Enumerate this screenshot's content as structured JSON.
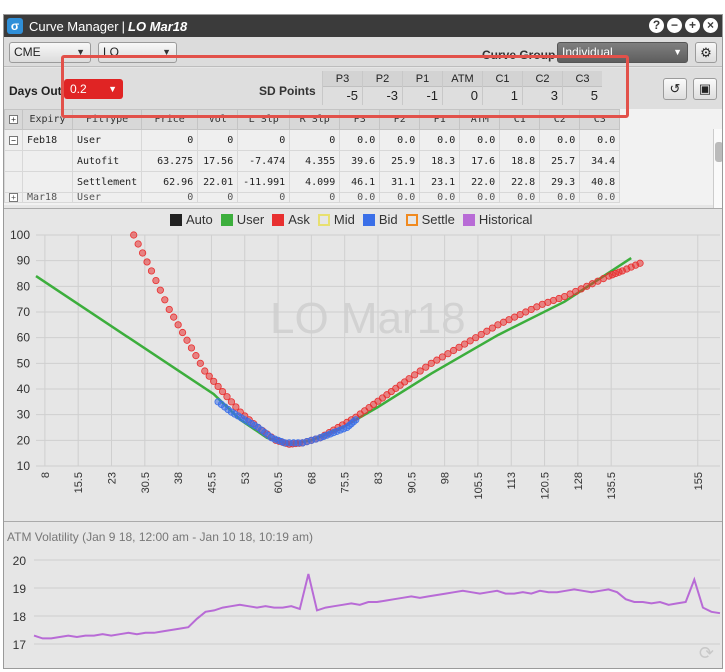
{
  "window": {
    "app_label": "Curve Manager",
    "separator": "|",
    "curve_label": "LO Mar18",
    "controls": {
      "help": "?",
      "minimize": "−",
      "add": "+",
      "close": "×"
    }
  },
  "toolbar": {
    "exchange_select": "CME",
    "product_select": "LO",
    "curve_group_label": "Curve Group",
    "curve_group_select": "Individual",
    "settings_icon": "gear-icon"
  },
  "params": {
    "days_out_label": "Days Out",
    "days_out_value": "0.2",
    "sd_points_label": "SD Points",
    "sd_points": [
      {
        "label": "P3",
        "value": "-5"
      },
      {
        "label": "P2",
        "value": "-3"
      },
      {
        "label": "P1",
        "value": "-1"
      },
      {
        "label": "ATM",
        "value": "0"
      },
      {
        "label": "C1",
        "value": "1"
      },
      {
        "label": "C2",
        "value": "3"
      },
      {
        "label": "C3",
        "value": "5"
      }
    ]
  },
  "table": {
    "columns": [
      "Expiry",
      "FitType",
      "Price",
      "Vol",
      "L Slp",
      "R Slp",
      "P3",
      "P2",
      "P1",
      "ATM",
      "C1",
      "C2",
      "C3"
    ],
    "rows": [
      {
        "expander": "−",
        "expiry": "Feb18",
        "fittype": "User",
        "price": "0",
        "vol": "0",
        "lslp": "0",
        "rslp": "0",
        "p3": "0.0",
        "p2": "0.0",
        "p1": "0.0",
        "atm": "0.0",
        "c1": "0.0",
        "c2": "0.0",
        "c3": "0.0"
      },
      {
        "expander": "",
        "expiry": "",
        "fittype": "Autofit",
        "price": "63.275",
        "vol": "17.56",
        "lslp": "-7.474",
        "rslp": "4.355",
        "p3": "39.6",
        "p2": "25.9",
        "p1": "18.3",
        "atm": "17.6",
        "c1": "18.8",
        "c2": "25.7",
        "c3": "34.4"
      },
      {
        "expander": "",
        "expiry": "",
        "fittype": "Settlement",
        "price": "62.96",
        "vol": "22.01",
        "lslp": "-11.991",
        "rslp": "4.099",
        "p3": "46.1",
        "p2": "31.1",
        "p1": "23.1",
        "atm": "22.0",
        "c1": "22.8",
        "c2": "29.3",
        "c3": "40.8"
      },
      {
        "expander": "+",
        "expiry": "Mar18",
        "fittype": "User",
        "price": "0",
        "vol": "0",
        "lslp": "0",
        "rslp": "0",
        "p3": "0.0",
        "p2": "0.0",
        "p1": "0.0",
        "atm": "0.0",
        "c1": "0.0",
        "c2": "0.0",
        "c3": "0.0"
      }
    ]
  },
  "legend": [
    {
      "label": "Auto",
      "color": "#222222",
      "style": "fill"
    },
    {
      "label": "User",
      "color": "#3cae3c",
      "style": "fill"
    },
    {
      "label": "Ask",
      "color": "#e83030",
      "style": "fill"
    },
    {
      "label": "Mid",
      "color": "#e8e070",
      "style": "outline"
    },
    {
      "label": "Bid",
      "color": "#3a6fe8",
      "style": "fill"
    },
    {
      "label": "Settle",
      "color": "#f08a20",
      "style": "outline"
    },
    {
      "label": "Historical",
      "color": "#b86bd6",
      "style": "fill"
    }
  ],
  "watermark": "LO Mar18",
  "chart_data": [
    {
      "type": "scatter",
      "title": "",
      "xlabel": "",
      "ylabel": "",
      "x_ticks": [
        "8",
        "15.5",
        "23",
        "30.5",
        "38",
        "45.5",
        "53",
        "60.5",
        "68",
        "75.5",
        "83",
        "90.5",
        "98",
        "105.5",
        "113",
        "120.5",
        "128",
        "135.5",
        "155"
      ],
      "xlim": [
        6,
        160
      ],
      "ylim": [
        10,
        100
      ],
      "y_ticks": [
        10,
        20,
        30,
        40,
        50,
        60,
        70,
        80,
        90,
        100
      ],
      "series": [
        {
          "name": "User",
          "kind": "line",
          "color": "#3cae3c",
          "points": [
            [
              6,
              84
            ],
            [
              46,
              38
            ],
            [
              52,
              28
            ],
            [
              58,
              21
            ],
            [
              63,
              18.5
            ],
            [
              68,
              20
            ],
            [
              75,
              25
            ],
            [
              83,
              33
            ],
            [
              95,
              46
            ],
            [
              110,
              61
            ],
            [
              125,
              74
            ],
            [
              140,
              91
            ]
          ]
        },
        {
          "name": "Ask",
          "kind": "markers",
          "color": "#e83030",
          "points": [
            [
              28,
              100
            ],
            [
              32,
              86
            ],
            [
              36,
              71
            ],
            [
              40,
              59
            ],
            [
              44,
              47
            ],
            [
              48,
              39
            ],
            [
              52,
              31
            ],
            [
              56,
              25
            ],
            [
              60,
              20
            ],
            [
              63,
              18.5
            ],
            [
              66,
              19
            ],
            [
              70,
              21
            ],
            [
              74,
              25
            ],
            [
              78,
              29
            ],
            [
              82,
              34
            ],
            [
              86,
              39
            ],
            [
              90,
              44
            ],
            [
              95,
              50
            ],
            [
              100,
              55
            ],
            [
              105,
              60
            ],
            [
              110,
              65
            ],
            [
              115,
              69
            ],
            [
              120,
              73
            ],
            [
              125,
              76
            ],
            [
              130,
              80
            ],
            [
              135,
              84
            ],
            [
              138,
              86
            ],
            [
              142,
              89
            ]
          ]
        },
        {
          "name": "Bid",
          "kind": "markers",
          "color": "#3a6fe8",
          "points": [
            [
              47,
              35
            ],
            [
              50,
              31
            ],
            [
              53,
              28
            ],
            [
              56,
              25
            ],
            [
              59,
              21
            ],
            [
              62,
              19
            ],
            [
              66,
              19
            ],
            [
              70,
              21
            ],
            [
              73,
              23
            ],
            [
              76,
              25
            ],
            [
              78,
              28
            ]
          ]
        }
      ]
    },
    {
      "type": "line",
      "title": "ATM Volatility (Jan 9 18, 12:00 am - Jan 10 18, 10:19 am)",
      "ylim": [
        16.5,
        20
      ],
      "y_ticks": [
        17,
        18,
        19,
        20
      ],
      "series": [
        {
          "name": "Historical",
          "color": "#b86bd6",
          "values": [
            17.3,
            17.2,
            17.2,
            17.25,
            17.3,
            17.25,
            17.3,
            17.3,
            17.35,
            17.3,
            17.35,
            17.4,
            17.35,
            17.4,
            17.4,
            17.45,
            17.5,
            17.55,
            17.6,
            17.9,
            18.15,
            18.2,
            18.3,
            18.35,
            18.4,
            18.35,
            18.3,
            18.35,
            18.3,
            18.3,
            18.35,
            18.25,
            19.5,
            18.2,
            18.3,
            18.35,
            18.4,
            18.45,
            18.4,
            18.5,
            18.5,
            18.55,
            18.6,
            18.65,
            18.7,
            18.65,
            18.7,
            18.75,
            18.8,
            18.85,
            18.9,
            18.85,
            18.8,
            18.85,
            18.9,
            18.8,
            18.8,
            18.85,
            18.8,
            18.9,
            18.85,
            18.85,
            18.9,
            18.95,
            18.9,
            18.85,
            18.9,
            18.95,
            18.85,
            18.6,
            18.5,
            18.5,
            18.45,
            18.5,
            18.4,
            18.45,
            18.5,
            19.3,
            18.3,
            18.15,
            18.1
          ]
        }
      ]
    }
  ]
}
